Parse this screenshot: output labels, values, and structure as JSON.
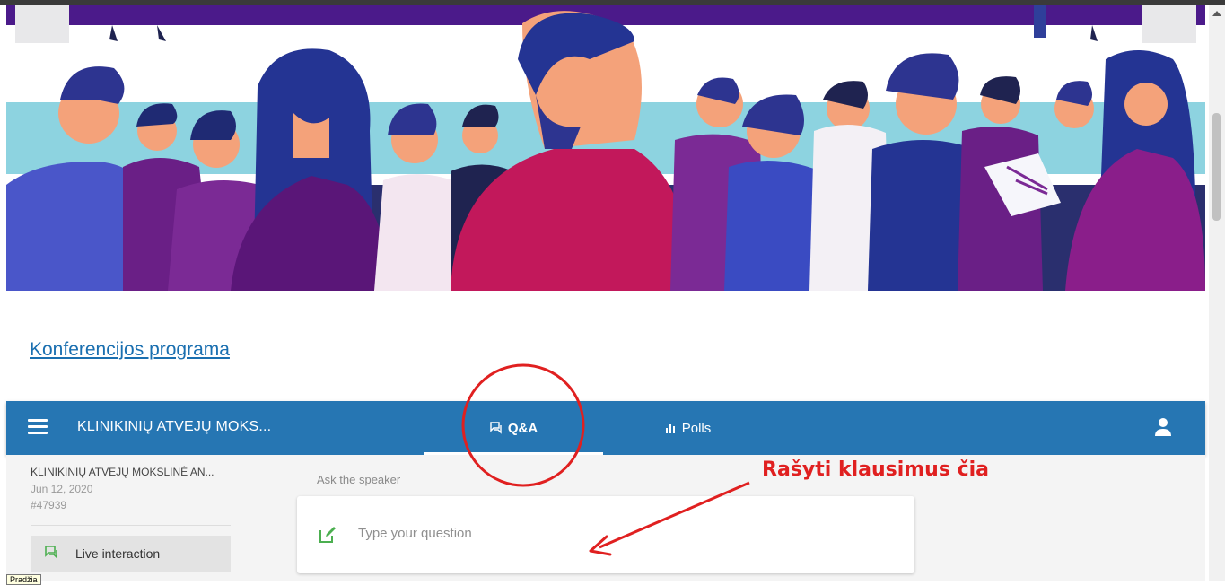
{
  "page": {
    "program_link": "Konferencijos programa"
  },
  "header": {
    "title": "KLINIKINIŲ ATVEJŲ MOKS...",
    "tabs": [
      {
        "label": "Q&A",
        "icon": "chat-bubbles-icon",
        "active": true
      },
      {
        "label": "Polls",
        "icon": "bar-chart-icon",
        "active": false
      }
    ]
  },
  "sidebar": {
    "event_name": "KLINIKINIŲ ATVEJŲ MOKSLINĖ AN...",
    "event_date": "Jun 12, 2020",
    "event_code": "#47939",
    "items": [
      {
        "label": "Live interaction",
        "icon": "live-chat-icon"
      }
    ]
  },
  "qa": {
    "ask_label": "Ask the speaker",
    "input_placeholder": "Type your question",
    "input_value": ""
  },
  "annotation": {
    "text": "Rašyti klausimus čia"
  },
  "tooltip": {
    "text": "Pradžia"
  },
  "colors": {
    "header": "#2676b3",
    "link": "#1a6fb0",
    "annotation": "#e02020",
    "accent_green": "#4caf50"
  }
}
